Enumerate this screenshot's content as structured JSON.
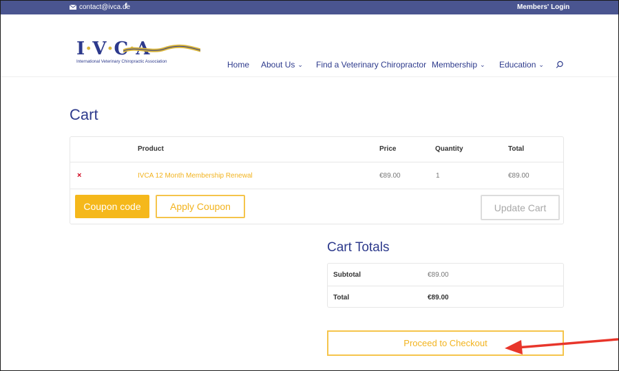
{
  "topbar": {
    "email": "contact@ivca.de",
    "facebook": "f",
    "login": "Members' Login"
  },
  "logo": {
    "mark_left": "I",
    "mark_dot1": "·",
    "mark_mid": "V",
    "mark_dot2": "·",
    "mark_c": "C",
    "mark_dot3": "·",
    "mark_right": "A",
    "tagline": "International Veterinary Chiropractic Association"
  },
  "nav": {
    "home": "Home",
    "about": "About Us",
    "find": "Find a Veterinary Chiropractor",
    "membership": "Membership",
    "education": "Education",
    "chevron": "⌄"
  },
  "page": {
    "title": "Cart"
  },
  "cart": {
    "headers": {
      "product": "Product",
      "price": "Price",
      "quantity": "Quantity",
      "total": "Total"
    },
    "rows": [
      {
        "remove": "×",
        "product": "IVCA 12 Month Membership Renewal",
        "price": "€89.00",
        "quantity": "1",
        "total": "€89.00"
      }
    ],
    "coupon_placeholder": "Coupon code",
    "apply_label": "Apply Coupon",
    "update_label": "Update Cart"
  },
  "totals": {
    "title": "Cart Totals",
    "subtotal_label": "Subtotal",
    "subtotal_value": "€89.00",
    "total_label": "Total",
    "total_value": "€89.00",
    "checkout_label": "Proceed to Checkout"
  },
  "colors": {
    "brand_blue": "#2d3a8c",
    "topbar": "#4a5590",
    "accent": "#f5b81b",
    "remove": "#d0021b",
    "arrow": "#e8362b"
  },
  "icons": [
    "envelope-icon",
    "facebook-icon",
    "chevron-down-icon",
    "search-icon",
    "remove-icon",
    "red-arrow-icon"
  ]
}
